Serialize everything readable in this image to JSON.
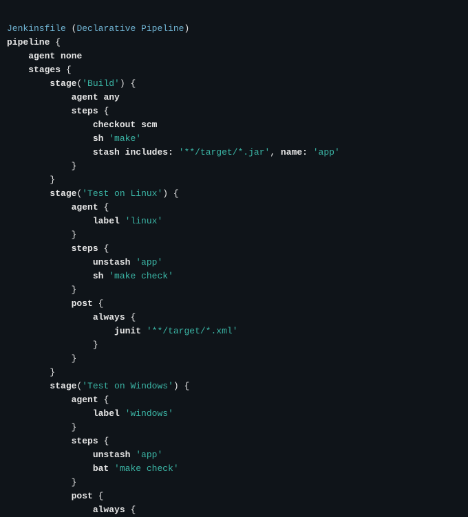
{
  "header": {
    "filename": "Jenkinsfile",
    "open_paren": " (",
    "comment": "Declarative Pipeline",
    "close_paren": ")"
  },
  "t": {
    "pipeline": "pipeline",
    "agent": "agent",
    "none": "none",
    "stages": "stages",
    "stage": "stage",
    "any": "any",
    "steps": "steps",
    "checkout": "checkout",
    "scm": "scm",
    "sh": "sh",
    "stash": "stash",
    "includes": "includes:",
    "name": "name:",
    "label": "label",
    "unstash": "unstash",
    "post": "post",
    "always": "always",
    "junit": "junit",
    "bat": "bat"
  },
  "s": {
    "build": "'Build'",
    "make": "'make'",
    "target_jar": "'**/target/*.jar'",
    "app": "'app'",
    "test_linux": "'Test on Linux'",
    "linux": "'linux'",
    "make_check": "'make check'",
    "target_xml": "'**/target/*.xml'",
    "test_windows": "'Test on Windows'",
    "windows": "'windows'"
  },
  "p": {
    "ob": " {",
    "cb": "}",
    "op": "(",
    "cp": ")",
    "comma": ", ",
    "sp": " "
  }
}
